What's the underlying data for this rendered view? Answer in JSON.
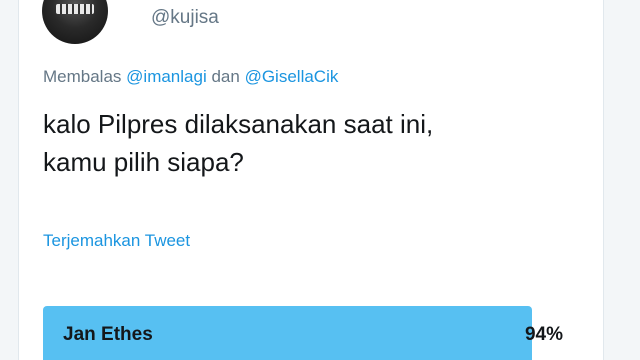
{
  "tweet": {
    "handle": "@kujisa",
    "reply_prefix": "Membalas",
    "mention_1": "@imanlagi",
    "reply_joiner": "dan",
    "mention_2": "@GisellaCik",
    "text_line_1": "kalo Pilpres dilaksanakan saat ini,",
    "text_line_2": "kamu pilih siapa?",
    "translate_link": "Terjemahkan Tweet"
  },
  "poll": {
    "options": [
      {
        "label": "Jan Ethes",
        "percent_text": "94%",
        "percent": 94
      }
    ],
    "bar_color": "#57c0f2"
  },
  "colors": {
    "link": "#1b95e0",
    "secondary_text": "#657786",
    "primary_text": "#14171a"
  }
}
